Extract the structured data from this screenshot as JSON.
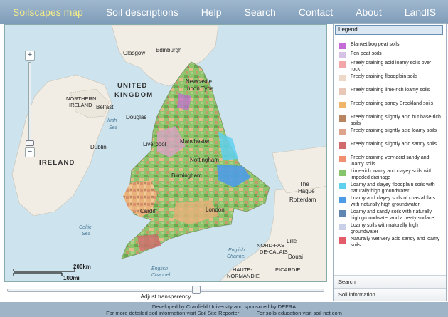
{
  "nav": {
    "items": [
      {
        "label": "Soilscapes map",
        "active": true
      },
      {
        "label": "Soil descriptions",
        "active": false
      },
      {
        "label": "Help",
        "active": false
      },
      {
        "label": "Search",
        "active": false
      },
      {
        "label": "Contact",
        "active": false
      },
      {
        "label": "About",
        "active": false
      },
      {
        "label": "LandIS",
        "active": false
      }
    ]
  },
  "map": {
    "zoom_in": "+",
    "zoom_out": "−",
    "places": {
      "glasgow": "Glasgow",
      "edinburgh": "Edinburgh",
      "newcastle": "Newcastle",
      "upon_tyne": "upon Tyne",
      "united": "UNITED",
      "kingdom": "KINGDOM",
      "northern": "NORTHERN",
      "ireland_n": "IRELAND",
      "belfast": "Belfast",
      "irish": "Irish",
      "sea": "Sea",
      "douglas": "Douglas",
      "dublin": "Dublin",
      "ireland": "IRELAND",
      "liverpool": "Liverpool",
      "manchester": "Manchester",
      "nottingham": "Nottingham",
      "birmingham": "Birmingham",
      "cardiff": "Cardiff",
      "london": "London",
      "celtic": "Celtic",
      "celtic_sea": "Sea",
      "english": "English",
      "channel": "Channel",
      "english2": "English",
      "channel2": "Channel",
      "the": "The",
      "hague": "Hague",
      "rotterdam": "Rotterdam",
      "nord": "NORD-PAS",
      "de_calais": "DE-CALAIS",
      "lille": "Lille",
      "douai": "Douai",
      "haute": "HAUTE-",
      "normandie": "NORMANDIE",
      "picardie": "PICARDIE"
    },
    "scale_km": "200km",
    "scale_mi": "100mi"
  },
  "transparency": {
    "label": "Adjust transparency",
    "value": 0.6
  },
  "legend": {
    "title": "Legend",
    "items": [
      {
        "label": "Blanket bog peat soils",
        "color": "#c56bd8"
      },
      {
        "label": "Fen peat soils",
        "color": "#d6c2e6"
      },
      {
        "label": "Freely draining acid loamy soils over rock",
        "color": "#f2a6a8"
      },
      {
        "label": "Freely draining floodplain soils",
        "color": "#ecd9c9"
      },
      {
        "label": "Freely draining lime-rich loamy soils",
        "color": "#e8c7b6"
      },
      {
        "label": "Freely draining sandy Breckland soils",
        "color": "#efb66b"
      },
      {
        "label": "Freely draining slightly acid but base-rich soils",
        "color": "#b88762"
      },
      {
        "label": "Freely draining slightly acid loamy soils",
        "color": "#dea38c"
      },
      {
        "label": "Freely draining slightly acid sandy soils",
        "color": "#d06a6c"
      },
      {
        "label": "Freely draining very acid sandy and loamy soils",
        "color": "#f08f72"
      },
      {
        "label": "Lime-rich loamy and clayey soils with impeded drainage",
        "color": "#86c56e"
      },
      {
        "label": "Loamy and clayey floodplain soils with naturally high groundwater",
        "color": "#5fd0ee"
      },
      {
        "label": "Loamy and clayey soils of coastal flats with naturally high groundwater",
        "color": "#4e9ce6"
      },
      {
        "label": "Loamy and sandy soils with naturally high groundwater and a peaty surface",
        "color": "#5f86b0"
      },
      {
        "label": "Loamy soils with naturally high groundwater",
        "color": "#c8cfe6"
      },
      {
        "label": "Naturally wet very acid sandy and loamy soils",
        "color": "#e35c6a"
      }
    ]
  },
  "panel_tabs": {
    "search": "Search",
    "soil_info": "Soil information"
  },
  "footer": {
    "line1": "Developed by Cranfield University and sponsored by DEFRA",
    "line2a": "For more detailed soil information visit",
    "link1": "Soil Site Reporter",
    "line2b": "For soils education visit",
    "link2": "soil-net.com"
  }
}
